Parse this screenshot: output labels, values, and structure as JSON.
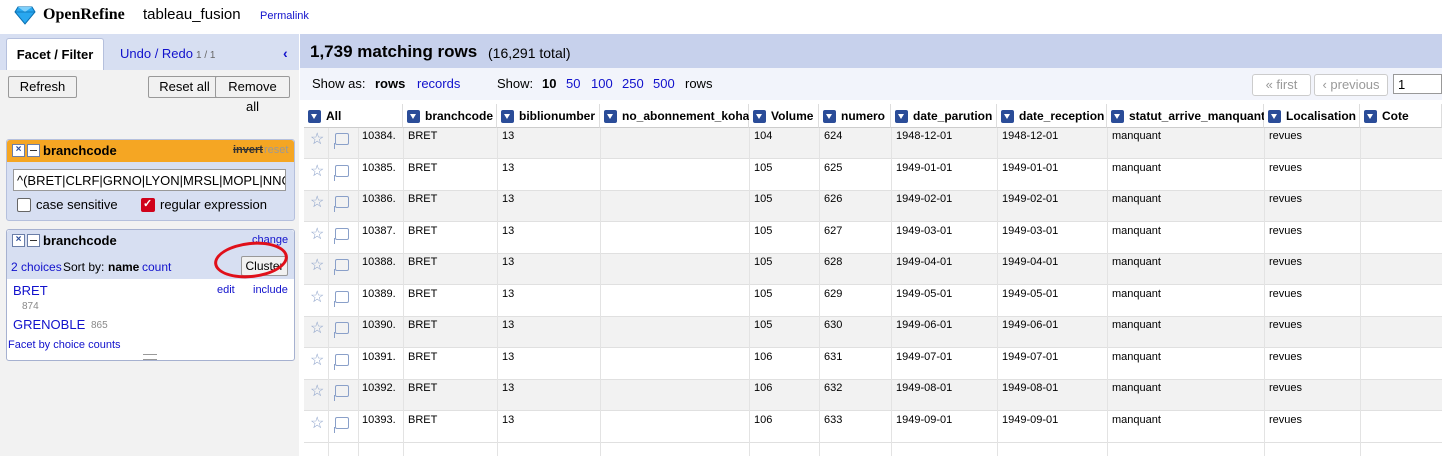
{
  "header": {
    "app_name": "OpenRefine",
    "project_name": "tableau_fusion",
    "permalink": "Permalink"
  },
  "left": {
    "tabs": [
      {
        "label": "Facet / Filter"
      },
      {
        "label": "Undo / Redo",
        "count": "1 / 1"
      }
    ],
    "refresh_label": "Refresh",
    "reset_all_label": "Reset all",
    "remove_all_label": "Remove all",
    "text_facet": {
      "title": "branchcode",
      "invert": "invert",
      "reset": "reset",
      "value": "^(BRET|CLRF|GRNO|LYON|MRSL|MOPL|NNC",
      "case_sensitive_label": "case sensitive",
      "case_sensitive_checked": false,
      "regex_label": "regular expression",
      "regex_checked": true
    },
    "list_facet": {
      "title": "branchcode",
      "change": "change",
      "choices_count": "2 choices",
      "sort_by": "Sort by:",
      "sort_name": "name",
      "sort_count": "count",
      "cluster_label": "Cluster",
      "choices": [
        {
          "name": "BRET",
          "count": "874",
          "edit": "edit",
          "include": "include"
        },
        {
          "name": "GRENOBLE",
          "count": "865"
        }
      ],
      "facet_by_counts": "Facet by choice counts"
    }
  },
  "summary": {
    "matching": "1,739 matching rows",
    "total": "(16,291 total)"
  },
  "viewbar": {
    "show_as": "Show as:",
    "rows": "rows",
    "records": "records",
    "show": "Show:",
    "page_sizes": [
      "10",
      "50",
      "100",
      "250",
      "500"
    ],
    "selected_page_size": "10",
    "rows_word": "rows",
    "first": "« first",
    "previous": "‹ previous",
    "page": "1"
  },
  "table": {
    "columns": [
      "All",
      "branchcode",
      "biblionumber",
      "no_abonnement_koha",
      "Volume",
      "numero",
      "date_parution",
      "date_reception",
      "statut_arrive_manquant",
      "Localisation",
      "Cote"
    ],
    "rows": [
      {
        "num": "10384.",
        "cells": [
          "BRET",
          "13",
          "",
          "104",
          "624",
          "1948-12-01",
          "1948-12-01",
          "manquant",
          "revues",
          ""
        ]
      },
      {
        "num": "10385.",
        "cells": [
          "BRET",
          "13",
          "",
          "105",
          "625",
          "1949-01-01",
          "1949-01-01",
          "manquant",
          "revues",
          ""
        ]
      },
      {
        "num": "10386.",
        "cells": [
          "BRET",
          "13",
          "",
          "105",
          "626",
          "1949-02-01",
          "1949-02-01",
          "manquant",
          "revues",
          ""
        ]
      },
      {
        "num": "10387.",
        "cells": [
          "BRET",
          "13",
          "",
          "105",
          "627",
          "1949-03-01",
          "1949-03-01",
          "manquant",
          "revues",
          ""
        ]
      },
      {
        "num": "10388.",
        "cells": [
          "BRET",
          "13",
          "",
          "105",
          "628",
          "1949-04-01",
          "1949-04-01",
          "manquant",
          "revues",
          ""
        ]
      },
      {
        "num": "10389.",
        "cells": [
          "BRET",
          "13",
          "",
          "105",
          "629",
          "1949-05-01",
          "1949-05-01",
          "manquant",
          "revues",
          ""
        ]
      },
      {
        "num": "10390.",
        "cells": [
          "BRET",
          "13",
          "",
          "105",
          "630",
          "1949-06-01",
          "1949-06-01",
          "manquant",
          "revues",
          ""
        ]
      },
      {
        "num": "10391.",
        "cells": [
          "BRET",
          "13",
          "",
          "106",
          "631",
          "1949-07-01",
          "1949-07-01",
          "manquant",
          "revues",
          ""
        ]
      },
      {
        "num": "10392.",
        "cells": [
          "BRET",
          "13",
          "",
          "106",
          "632",
          "1949-08-01",
          "1949-08-01",
          "manquant",
          "revues",
          ""
        ]
      },
      {
        "num": "10393.",
        "cells": [
          "BRET",
          "13",
          "",
          "106",
          "633",
          "1949-09-01",
          "1949-09-01",
          "manquant",
          "revues",
          ""
        ]
      }
    ]
  },
  "colors": {
    "accent_link": "#1111cc",
    "facet_header_active": "#f5a623",
    "panel_blue": "#d7dff2",
    "annotation_red": "#e0101a"
  }
}
